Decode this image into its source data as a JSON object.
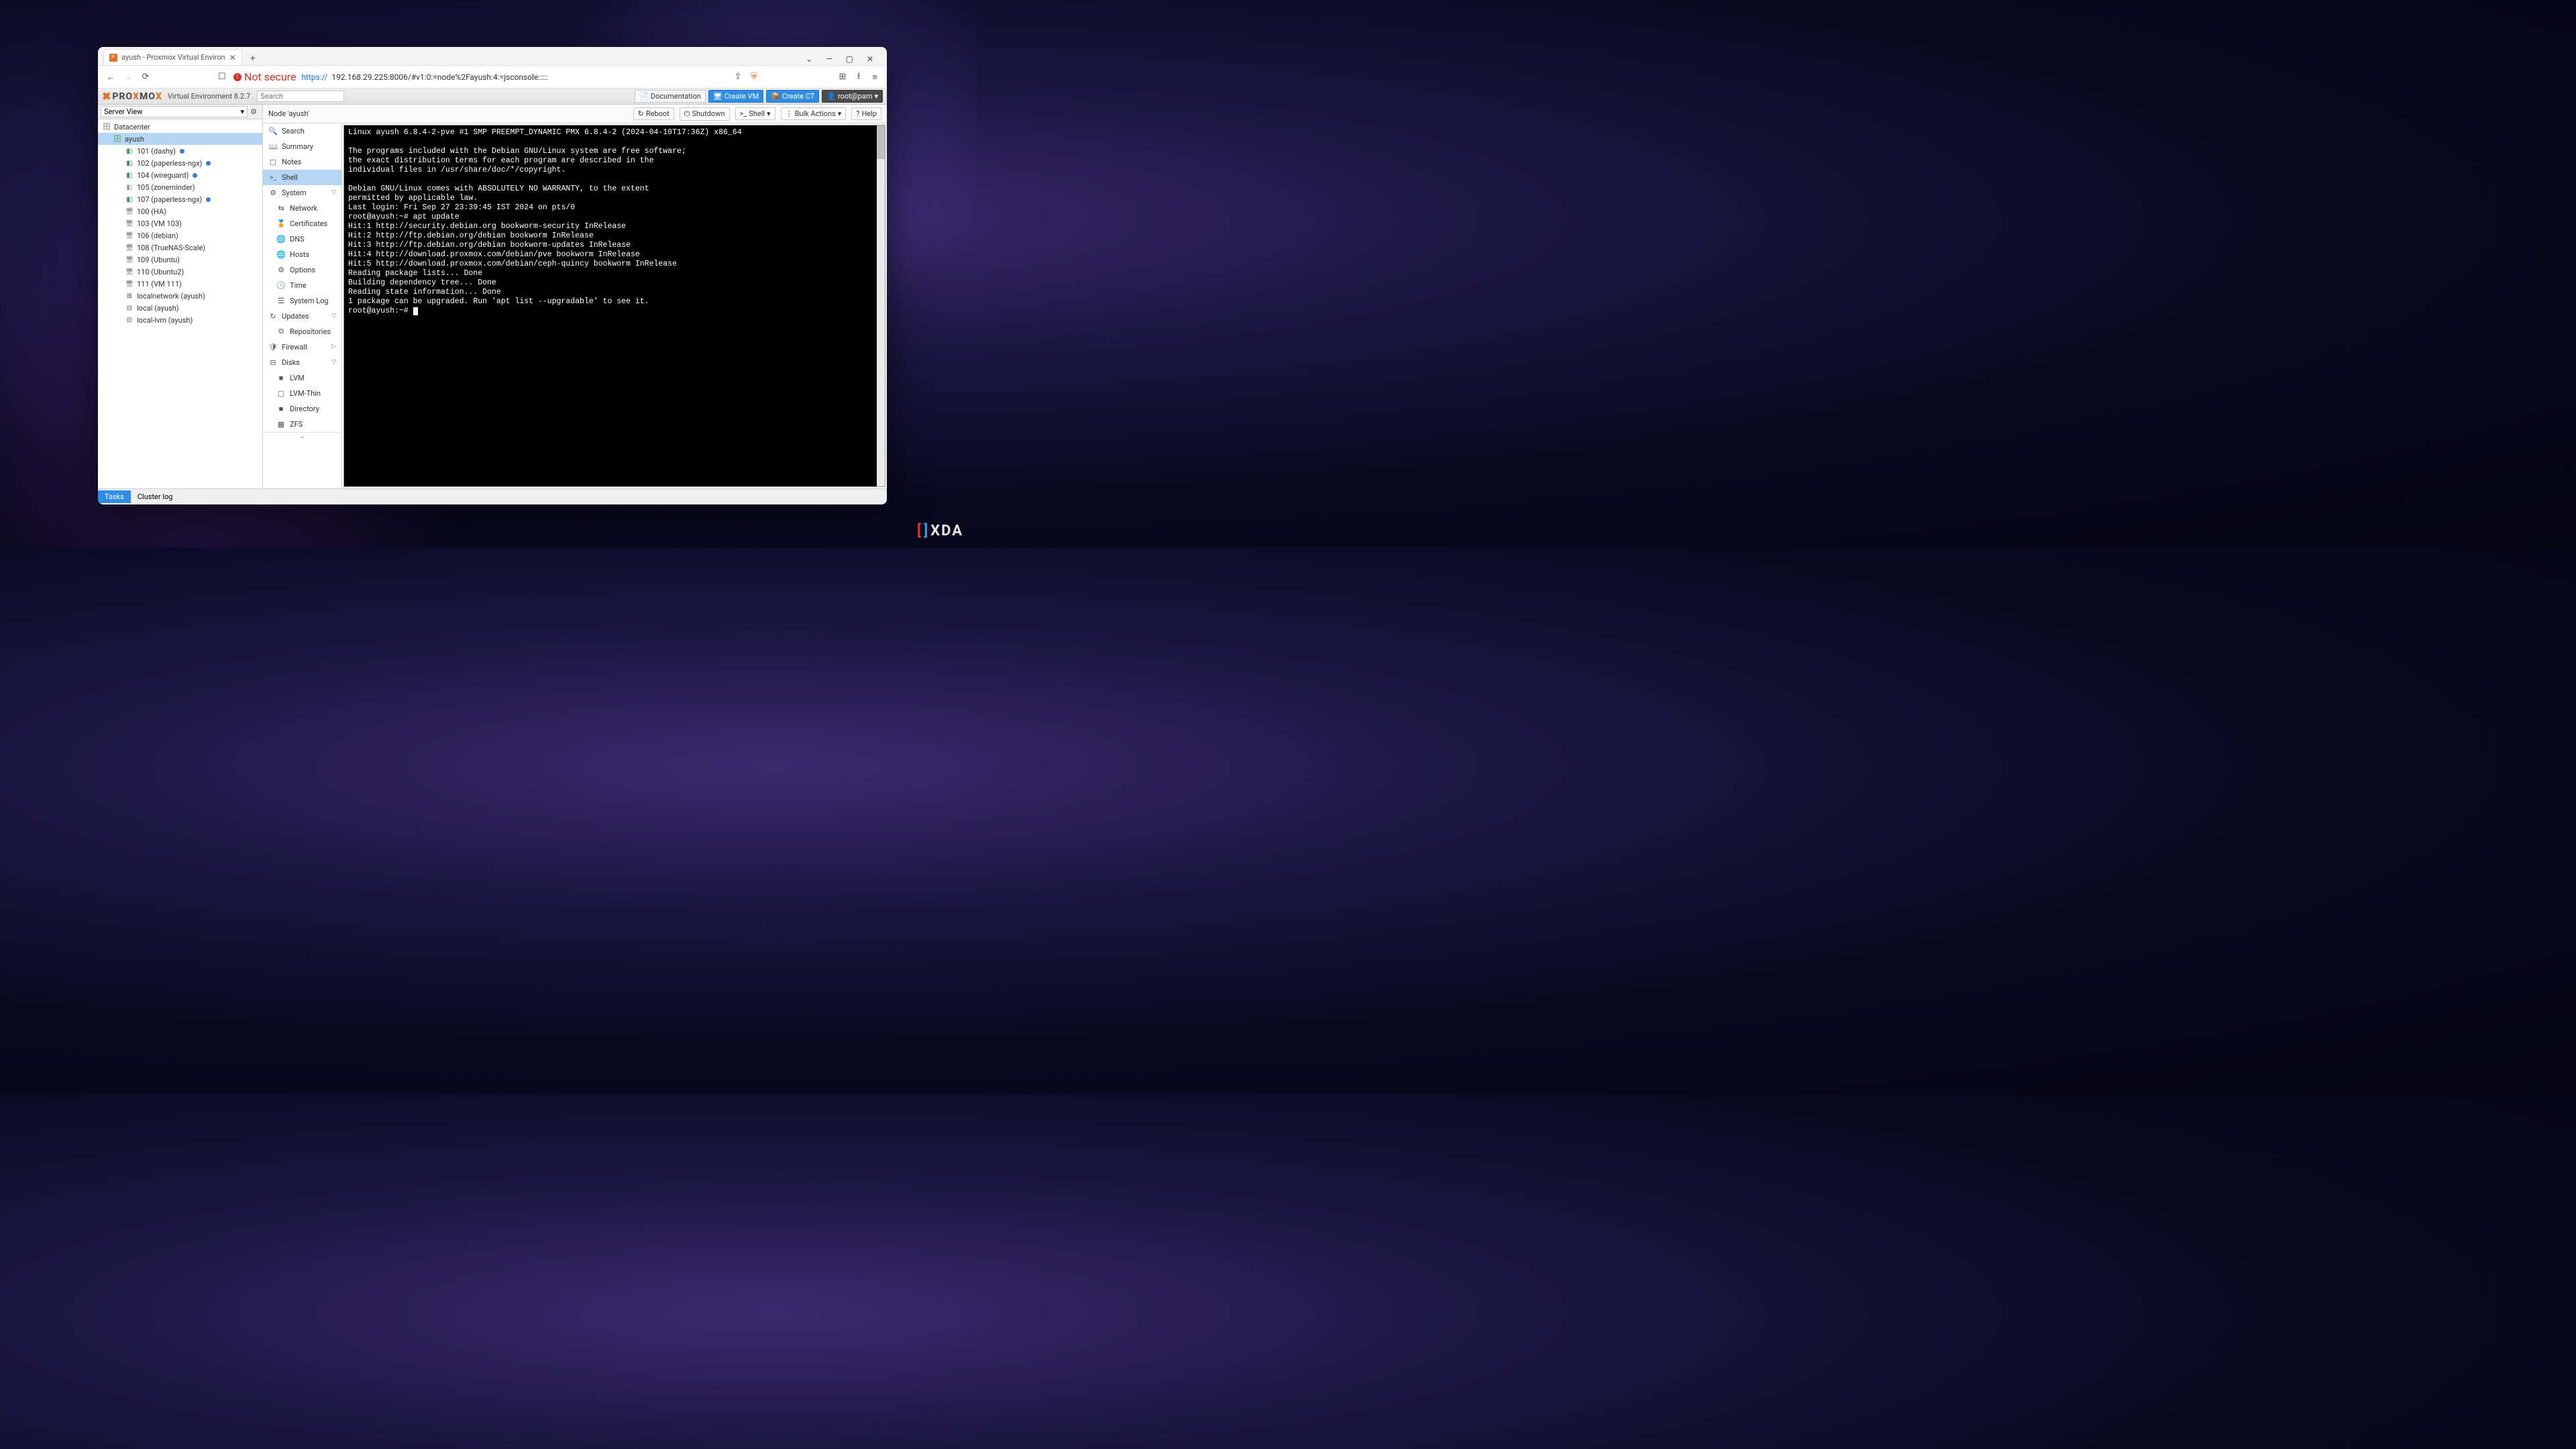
{
  "browser": {
    "tab_title": "ayush - Proxmox Virtual Environ",
    "insecure": "Not secure",
    "url_prefix": "https://",
    "url_rest": "192.168.29.225:8006/#v1:0:=node%2Fayush:4:=jsconsole:::::"
  },
  "topbar": {
    "logo_prefix": "PRO",
    "logo_mid": "X",
    "logo_suffix": "MO",
    "logo_end": "X",
    "product": "Virtual Environment 8.2.7",
    "search_placeholder": "Search",
    "doc": "Documentation",
    "create_vm": "Create VM",
    "create_ct": "Create CT",
    "user": "root@pam"
  },
  "view": {
    "label": "Server View"
  },
  "tree": {
    "dc": "Datacenter",
    "node": "ayush",
    "items": [
      {
        "id": "101",
        "label": "101 (dashy)",
        "running": true,
        "dot": true,
        "type": "ct"
      },
      {
        "id": "102",
        "label": "102 (paperless-ngx)",
        "running": true,
        "dot": true,
        "type": "ct"
      },
      {
        "id": "104",
        "label": "104 (wireguard)",
        "running": true,
        "dot": true,
        "type": "ct"
      },
      {
        "id": "105",
        "label": "105 (zoneminder)",
        "running": false,
        "dot": false,
        "type": "ct"
      },
      {
        "id": "107",
        "label": "107 (paperless-ngx)",
        "running": true,
        "dot": true,
        "type": "ct"
      },
      {
        "id": "100",
        "label": "100 (HA)",
        "running": false,
        "dot": false,
        "type": "vm"
      },
      {
        "id": "103",
        "label": "103 (VM 103)",
        "running": false,
        "dot": false,
        "type": "vm"
      },
      {
        "id": "106",
        "label": "106 (debian)",
        "running": false,
        "dot": false,
        "type": "vm"
      },
      {
        "id": "108",
        "label": "108 (TrueNAS-Scale)",
        "running": false,
        "dot": false,
        "type": "vm"
      },
      {
        "id": "109",
        "label": "109 (Ubuntu)",
        "running": false,
        "dot": false,
        "type": "vm"
      },
      {
        "id": "110",
        "label": "110 (Ubuntu2)",
        "running": false,
        "dot": false,
        "type": "vm"
      },
      {
        "id": "111",
        "label": "111 (VM 111)",
        "running": false,
        "dot": false,
        "type": "vm"
      }
    ],
    "storage": [
      "localnetwork (ayush)",
      "local (ayush)",
      "local-lvm (ayush)"
    ]
  },
  "crumb": {
    "title": "Node 'ayush'",
    "reboot": "Reboot",
    "shutdown": "Shutdown",
    "shell": "Shell",
    "bulk": "Bulk Actions",
    "help": "Help"
  },
  "menu": {
    "search": "Search",
    "summary": "Summary",
    "notes": "Notes",
    "shell": "Shell",
    "system": "System",
    "network": "Network",
    "certs": "Certificates",
    "dns": "DNS",
    "hosts": "Hosts",
    "options": "Options",
    "time": "Time",
    "syslog": "System Log",
    "updates": "Updates",
    "repos": "Repositories",
    "firewall": "Firewall",
    "disks": "Disks",
    "lvm": "LVM",
    "lvmthin": "LVM-Thin",
    "directory": "Directory",
    "zfs": "ZFS"
  },
  "terminal": "Linux ayush 6.8.4-2-pve #1 SMP PREEMPT_DYNAMIC PMX 6.8.4-2 (2024-04-10T17:36Z) x86_64\n\nThe programs included with the Debian GNU/Linux system are free software;\nthe exact distribution terms for each program are described in the\nindividual files in /usr/share/doc/*/copyright.\n\nDebian GNU/Linux comes with ABSOLUTELY NO WARRANTY, to the extent\npermitted by applicable law.\nLast login: Fri Sep 27 23:39:45 IST 2024 on pts/0\nroot@ayush:~# apt update\nHit:1 http://security.debian.org bookworm-security InRelease\nHit:2 http://ftp.debian.org/debian bookworm InRelease\nHit:3 http://ftp.debian.org/debian bookworm-updates InRelease\nHit:4 http://download.proxmox.com/debian/pve bookworm InRelease\nHit:5 http://download.proxmox.com/debian/ceph-quincy bookworm InRelease\nReading package lists... Done\nBuilding dependency tree... Done\nReading state information... Done\n1 package can be upgraded. Run 'apt list --upgradable' to see it.\nroot@ayush:~# ",
  "bottom": {
    "tasks": "Tasks",
    "cluster": "Cluster log"
  },
  "watermark": "XDA"
}
